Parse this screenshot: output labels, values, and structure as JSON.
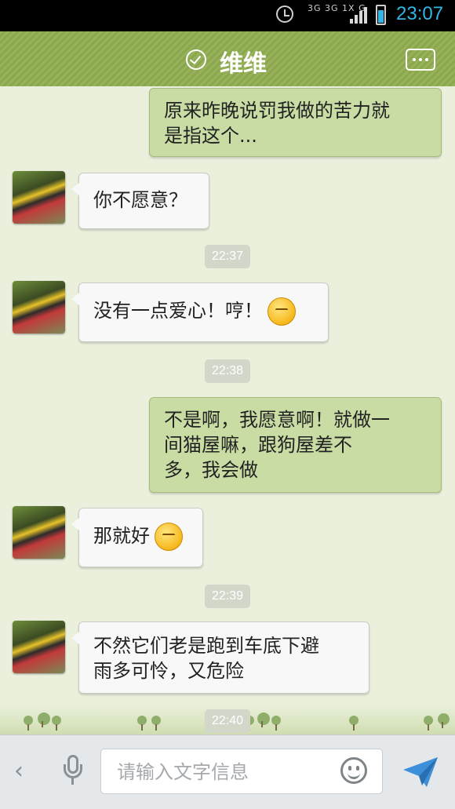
{
  "status_bar": {
    "network_label": "3G 3G 1X G",
    "time": "23:07",
    "battery_color": "#33b5e5"
  },
  "header": {
    "title": "维维",
    "verified_icon": "check-circle-icon",
    "menu_icon": "more-icon",
    "bg_color": "#97b25a"
  },
  "messages": [
    {
      "side": "out",
      "text_lines": [
        "原来昨晚说罚我做的苦力就",
        "是指这个..."
      ]
    },
    {
      "side": "in",
      "text_lines": [
        "你不愿意？"
      ]
    },
    {
      "timestamp": "22:37"
    },
    {
      "side": "in",
      "text_lines": [
        "没有一点爱心！哼！"
      ],
      "emoji": "smirk-emoji"
    },
    {
      "timestamp": "22:38"
    },
    {
      "side": "out",
      "text_lines": [
        "不是啊，我愿意啊！就做一",
        "间猫屋嘛，跟狗屋差不",
        "多，我会做"
      ]
    },
    {
      "side": "in",
      "text_lines": [
        "那就好"
      ],
      "emoji": "content-emoji"
    },
    {
      "timestamp": "22:39"
    },
    {
      "side": "in",
      "text_lines": [
        "不然它们老是跑到车底下避",
        "雨多可怜，又危险"
      ]
    },
    {
      "timestamp": "22:40"
    }
  ],
  "input_bar": {
    "placeholder": "请输入文字信息",
    "back_icon": "chevron-left-icon",
    "mic_icon": "microphone-icon",
    "emoji_icon": "smiley-icon",
    "send_icon": "send-icon",
    "send_color": "#3c8fd8"
  }
}
